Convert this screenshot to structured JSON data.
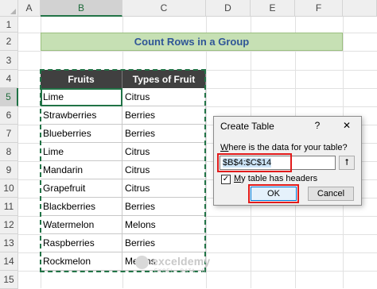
{
  "columns": [
    "A",
    "B",
    "C",
    "D",
    "E",
    "F"
  ],
  "rows": [
    "1",
    "2",
    "3",
    "4",
    "5",
    "6",
    "7",
    "8",
    "9",
    "10",
    "11",
    "12",
    "13",
    "14",
    "15"
  ],
  "title": "Count Rows in a Group",
  "table": {
    "headers": [
      "Fruits",
      "Types of Fruit"
    ],
    "rows": [
      [
        "Lime",
        "Citrus"
      ],
      [
        "Strawberries",
        "Berries"
      ],
      [
        "Blueberries",
        "Berries"
      ],
      [
        "Lime",
        "Citrus"
      ],
      [
        "Mandarin",
        "Citrus"
      ],
      [
        "Grapefruit",
        "Citrus"
      ],
      [
        "Blackberries",
        "Berries"
      ],
      [
        "Watermelon",
        "Melons"
      ],
      [
        "Raspberries",
        "Berries"
      ],
      [
        "Rockmelon",
        "Melons"
      ]
    ]
  },
  "dialog": {
    "title": "Create Table",
    "help": "?",
    "close": "✕",
    "prompt": "Where is the data for your table?",
    "prompt_hotkey": "W",
    "prompt_rest": "here is the data for your table?",
    "range_value": "$B$4:$C$14",
    "collapse_icon": "⭡",
    "checkbox_checked": true,
    "checkbox_mark": "✓",
    "checkbox_hotkey": "M",
    "checkbox_rest": "y table has headers",
    "ok_label": "OK",
    "cancel_label": "Cancel"
  },
  "watermark": {
    "text": "exceldemy",
    "sub": "EXCEL · DATA · BI"
  },
  "colors": {
    "accent_green": "#217346",
    "title_fill": "#c6e0b4",
    "title_text": "#2f5597",
    "header_fill": "#404040",
    "highlight_red": "#e21b1b"
  }
}
